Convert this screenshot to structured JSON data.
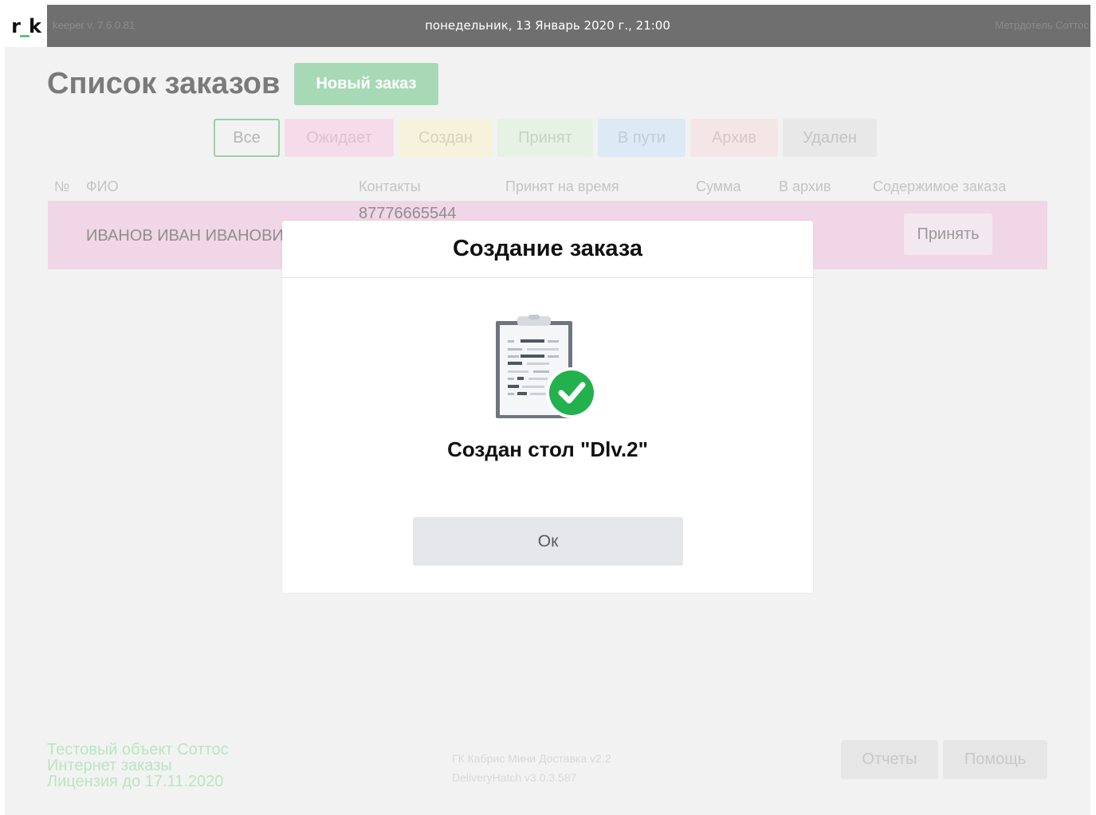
{
  "header": {
    "logo_left": "r",
    "logo_mid": "_",
    "logo_right": "k",
    "version": "keeper v. 7.6.0.81",
    "datetime": "понедельник, 13 Январь 2020 г., 21:00",
    "user": "Метрдотель Соттос"
  },
  "page": {
    "title": "Список заказов",
    "new_order_label": "Новый заказ"
  },
  "filters": [
    {
      "label": "Все",
      "color": "#9bcfa8"
    },
    {
      "label": "Ожидает",
      "color": "#f6dcea"
    },
    {
      "label": "Создан",
      "color": "#f6f2dc"
    },
    {
      "label": "Принят",
      "color": "#e6f2e4"
    },
    {
      "label": "В пути",
      "color": "#dde9f4"
    },
    {
      "label": "Архив",
      "color": "#f4e6e6"
    },
    {
      "label": "Удален",
      "color": "#e8e8e8"
    }
  ],
  "table": {
    "columns": [
      "№",
      "ФИО",
      "Контакты",
      "Принят на время",
      "Сумма",
      "В архив",
      "Содержимое заказа"
    ],
    "rows": [
      {
        "name": "ИВАНОВ ИВАН ИВАНОВИЧ",
        "phone": "87776665544",
        "action_label": "Принять"
      }
    ]
  },
  "footer": {
    "left_lines": [
      "Тестовый объект Соттос",
      "Интернет заказы",
      "Лицензия до 17.11.2020"
    ],
    "mid_lines": [
      "ГК Кабрис Мини Доставка v2.2",
      "DeliveryHatch v3.0.3.587"
    ],
    "reports_label": "Отчеты",
    "help_label": "Помощь"
  },
  "modal": {
    "title": "Создание заказа",
    "icon": "clipboard-check-icon",
    "message": "Создан стол \"Dlv.2\"",
    "ok_label": "Ок"
  }
}
